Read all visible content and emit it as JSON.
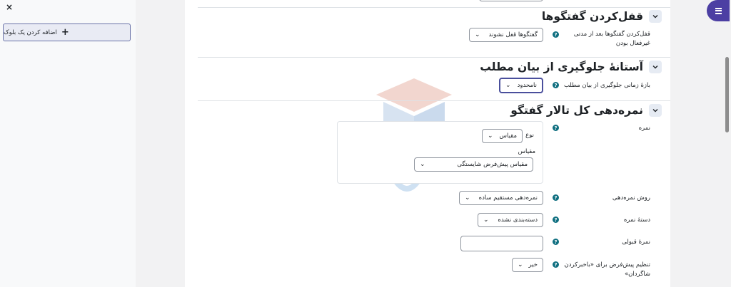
{
  "drawer": {
    "close_icon": "×",
    "add_block_label": "اضافه کردن یک بلوک",
    "add_block_icon": "+"
  },
  "sections": {
    "lock": {
      "title": "قفل‌کردن گفتگوها",
      "field_label": "قفل‌کردن گفتگوها بعد از مدتی غیرفعال بودن",
      "select_value": "گفتگوها قفل نشوند"
    },
    "threshold": {
      "title": "آستانهٔ جلوگیری از بیان مطلب",
      "field_label": "بازهٔ زمانی جلوگیری از بیان مطلب",
      "select_value": "نامحدود"
    },
    "grading": {
      "title": "نمره‌دهی کل تالار گفتگو",
      "grade_label": "نمره",
      "type_label": "نوع",
      "type_value": "مقیاس",
      "scale_label": "مقیاس",
      "scale_value": "مقیاس پیش‌فرض شایستگی",
      "method_label": "روش نمره‌دهی",
      "method_value": "نمره‌دهی مستقیم ساده",
      "category_label": "دستهٔ نمره",
      "category_value": "دسته‌بندی نشده",
      "pass_label": "نمرهٔ قبولی",
      "pass_value": "",
      "notify_label": "تنظیم پیش‌فرض برای «باخبرکردن شاگردان»",
      "notify_value": "خیر"
    }
  },
  "help_glyph": "?",
  "chevron_glyph": "⌄",
  "colors": {
    "accent": "#4c3fa3",
    "help": "#0f6f80",
    "focus": "#4a4f9c"
  }
}
